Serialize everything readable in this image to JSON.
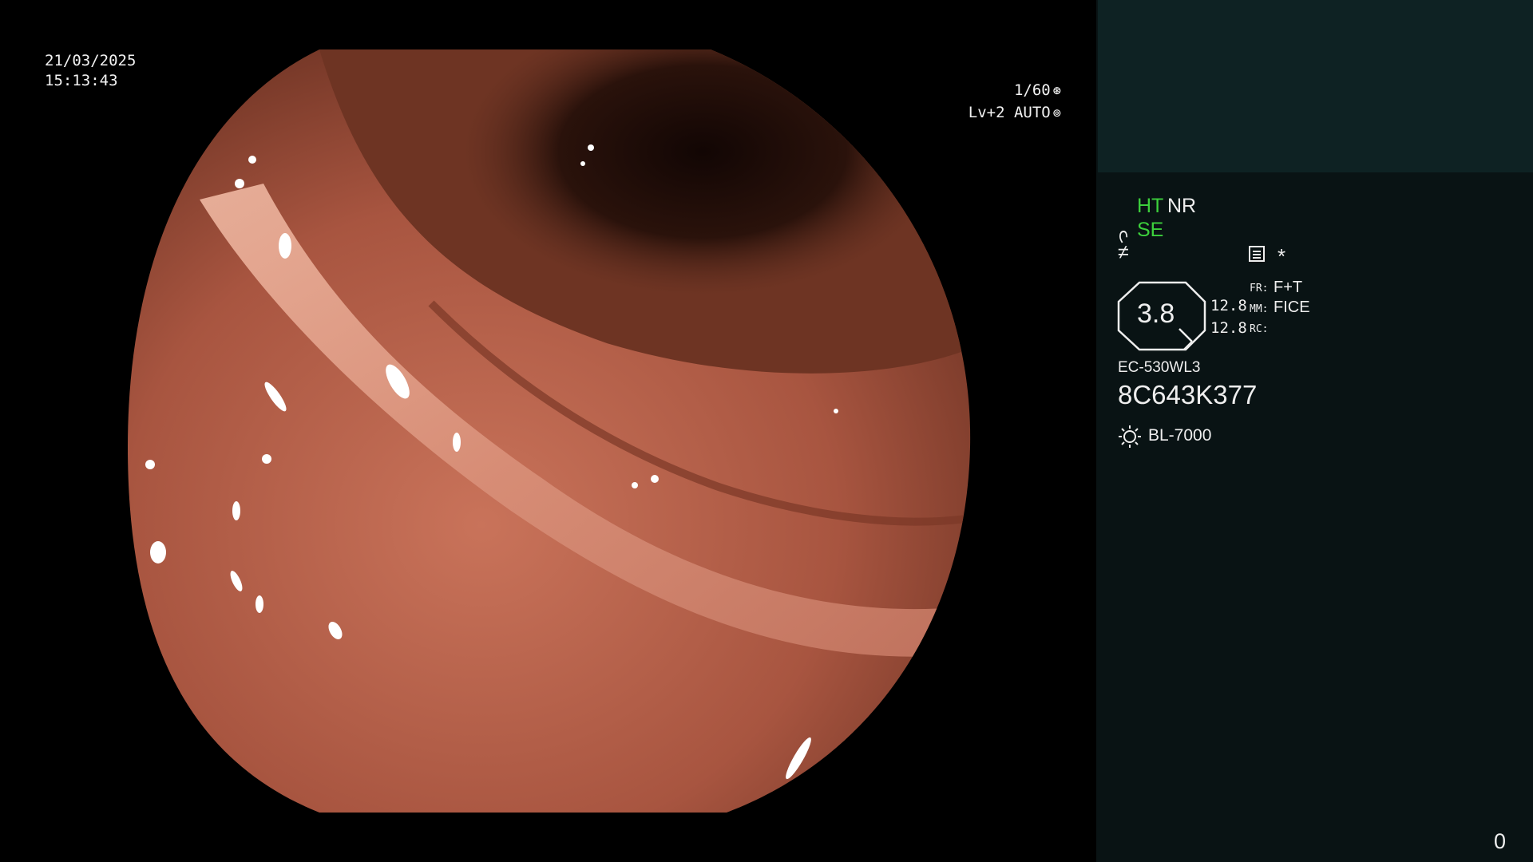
{
  "overlay": {
    "date": "21/03/2025",
    "time": "15:13:43",
    "shutter": "1/60",
    "shutter_icon": "aperture-icon",
    "level_mode": "Lv+2 AUTO",
    "level_icon": "iris-icon"
  },
  "panel": {
    "ht": "HT",
    "nr": "NR",
    "se": "SE",
    "se_icon": "curve-icon",
    "filter_icon": "not-equal-icon",
    "memo_icon": "document-icon",
    "star": "*",
    "zoom_value": "3.8",
    "val1": "12.8",
    "val2": "12.8",
    "fr_label": "FR:",
    "fr_value": "F+T",
    "mm_label": "MM:",
    "mm_value": "FICE",
    "rc_label": "RC:",
    "scope_model": "EC-530WL3",
    "serial": "8C643K377",
    "light_icon": "sun-icon",
    "light_source": "BL-7000",
    "corner_counter": "0",
    "colors": {
      "panel_bg": "#091314",
      "thumb_bg": "#0e2223",
      "accent_green": "#3ccf3c"
    }
  }
}
